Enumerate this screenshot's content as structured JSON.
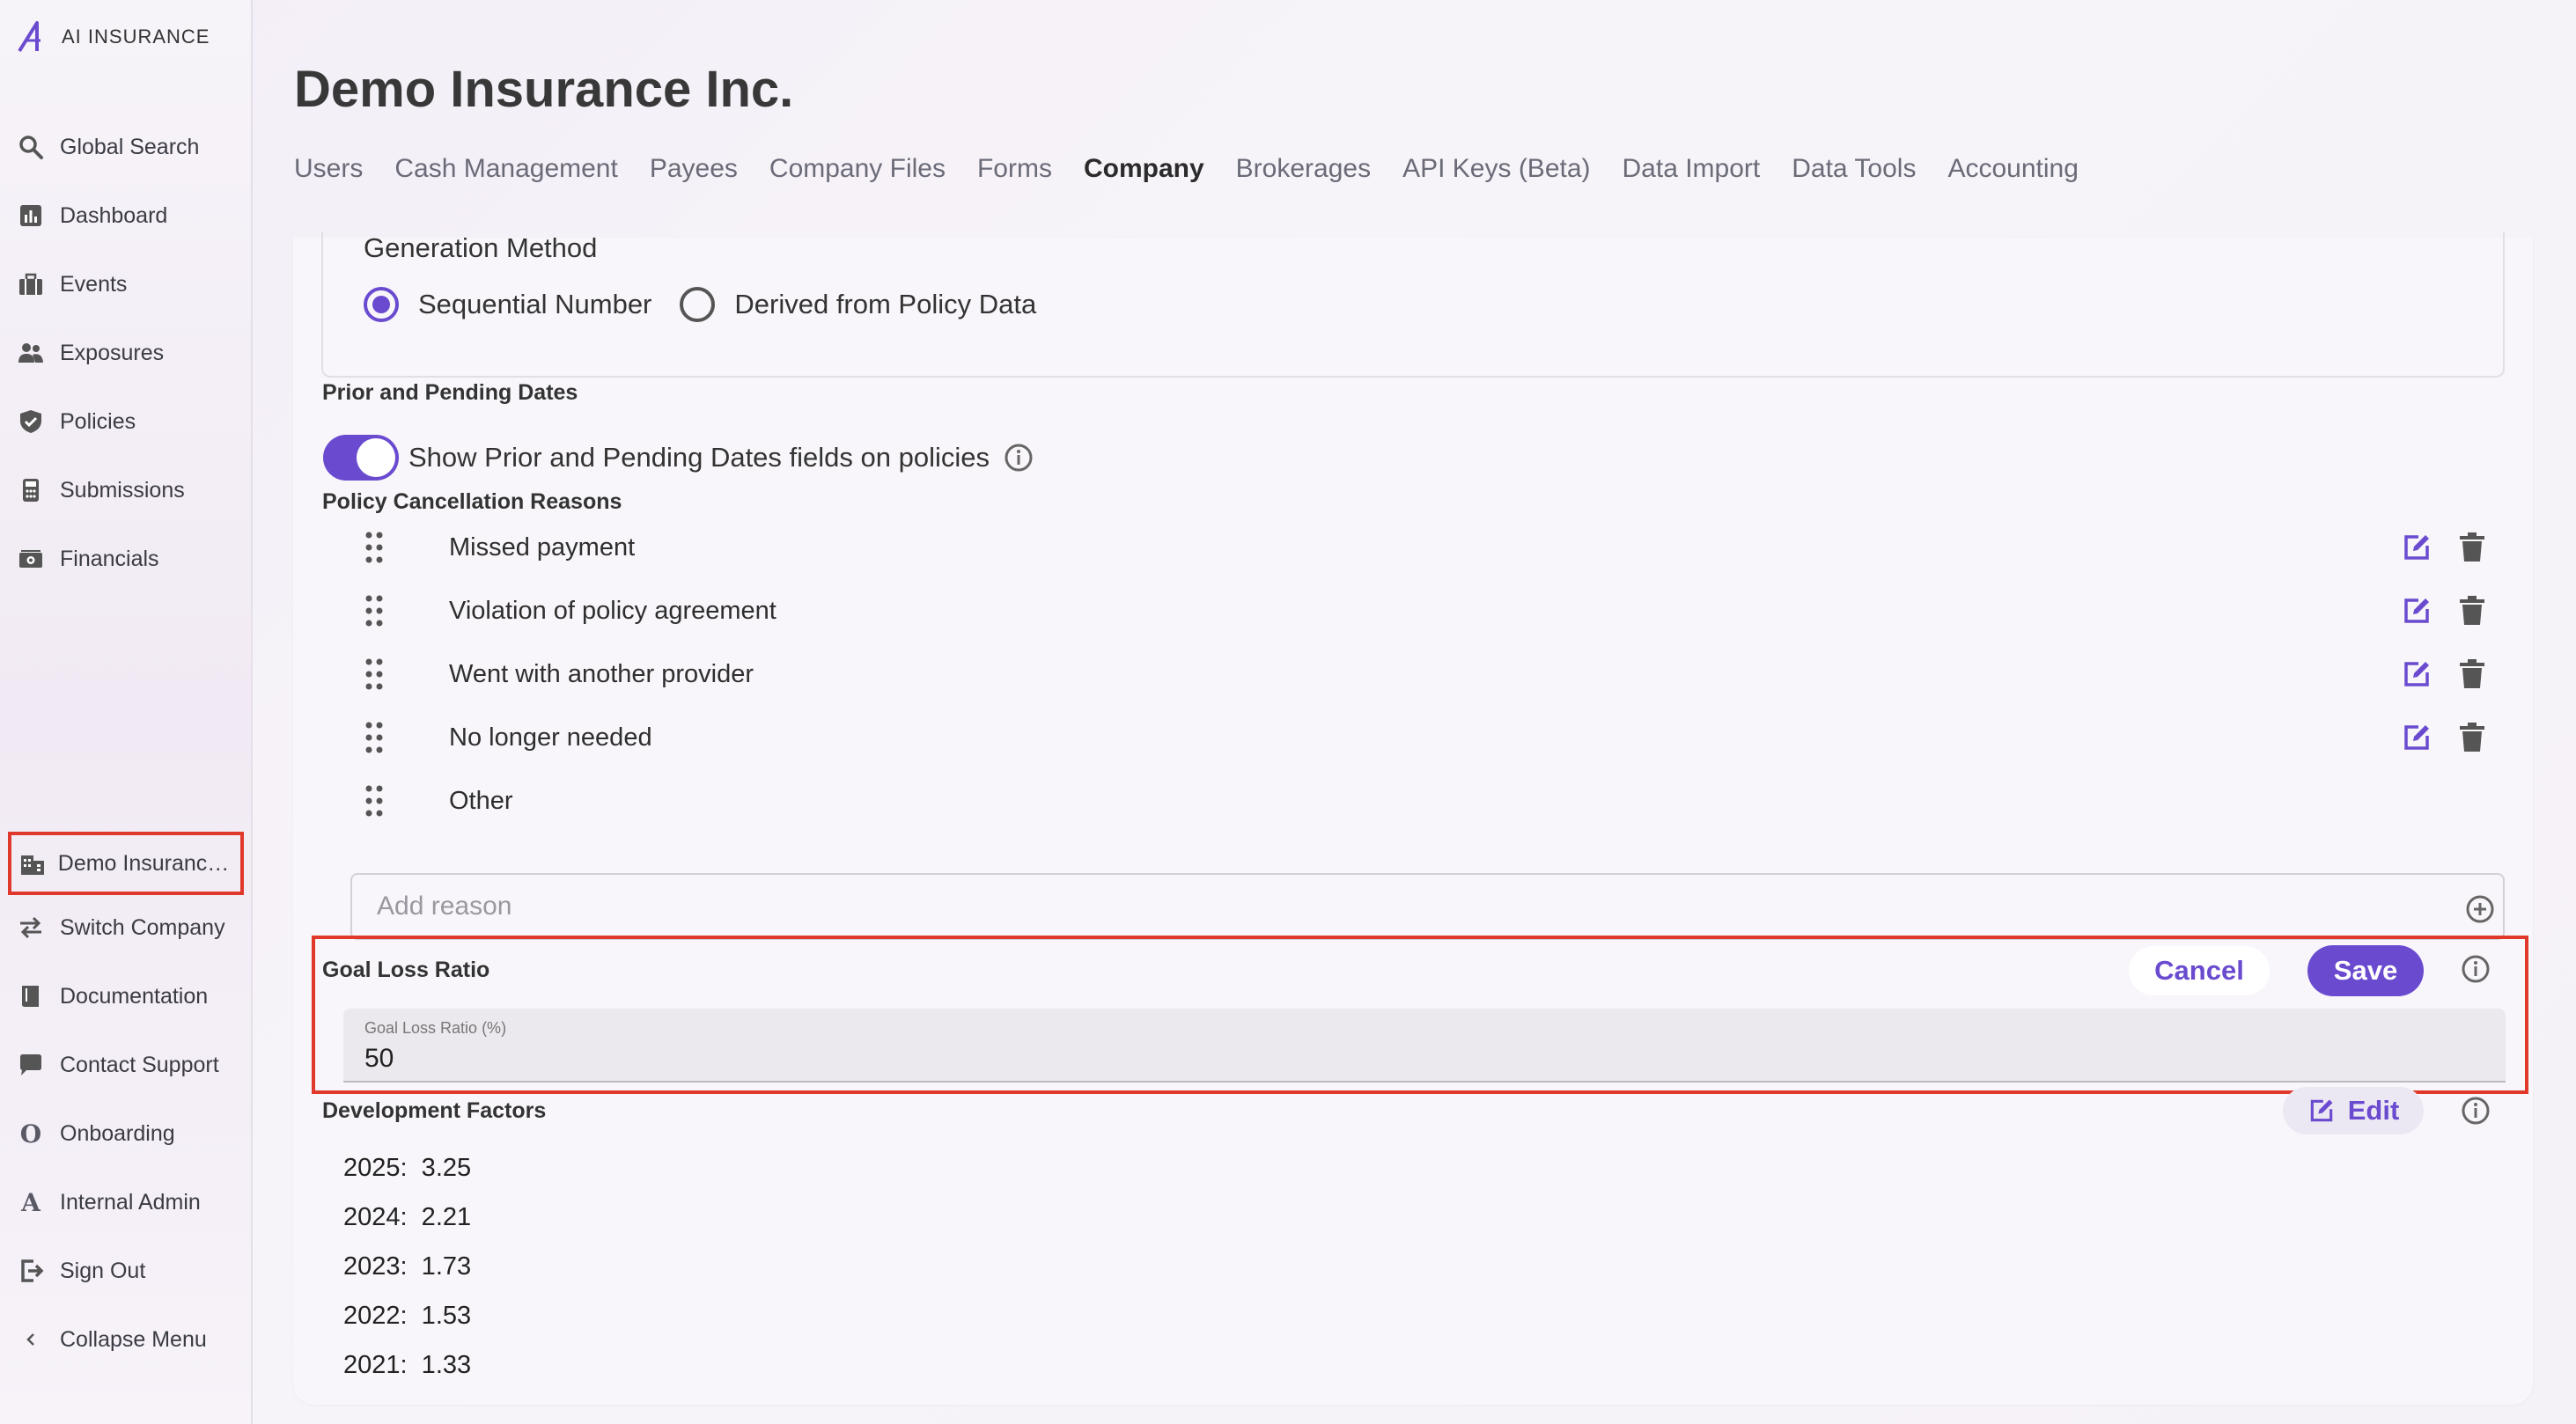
{
  "app": {
    "brand": "AI INSURANCE"
  },
  "sidebar": {
    "items": [
      {
        "label": "Global Search",
        "icon": "search-icon"
      },
      {
        "label": "Dashboard",
        "icon": "dashboard-icon"
      },
      {
        "label": "Events",
        "icon": "briefcase-icon"
      },
      {
        "label": "Exposures",
        "icon": "people-icon"
      },
      {
        "label": "Policies",
        "icon": "shield-icon"
      },
      {
        "label": "Submissions",
        "icon": "calculator-icon"
      },
      {
        "label": "Financials",
        "icon": "money-icon"
      }
    ],
    "bottom_items": [
      {
        "label": "Demo Insurance Inc.",
        "icon": "building-icon"
      },
      {
        "label": "Switch Company",
        "icon": "switch-icon"
      },
      {
        "label": "Documentation",
        "icon": "book-icon"
      },
      {
        "label": "Contact Support",
        "icon": "chat-icon"
      },
      {
        "label": "Onboarding",
        "icon": "letter-o-icon",
        "glyph": "O"
      },
      {
        "label": "Internal Admin",
        "icon": "letter-a-icon",
        "glyph": "A"
      },
      {
        "label": "Sign Out",
        "icon": "sign-out-icon"
      },
      {
        "label": "Collapse Menu",
        "icon": "chevron-left-icon"
      }
    ]
  },
  "header": {
    "title": "Demo Insurance Inc.",
    "tabs": [
      {
        "label": "Users"
      },
      {
        "label": "Cash Management"
      },
      {
        "label": "Payees"
      },
      {
        "label": "Company Files"
      },
      {
        "label": "Forms"
      },
      {
        "label": "Company",
        "active": true
      },
      {
        "label": "Brokerages"
      },
      {
        "label": "API Keys (Beta)"
      },
      {
        "label": "Data Import"
      },
      {
        "label": "Data Tools"
      },
      {
        "label": "Accounting"
      }
    ]
  },
  "generation": {
    "title": "Generation Method",
    "options": [
      "Sequential Number",
      "Derived from Policy Data"
    ],
    "selected": "Sequential Number"
  },
  "prior_pending": {
    "section": "Prior and Pending Dates",
    "toggle_label": "Show Prior and Pending Dates fields on policies",
    "enabled": true
  },
  "cancellation": {
    "section": "Policy Cancellation Reasons",
    "reasons": [
      {
        "text": "Missed payment",
        "editable": true
      },
      {
        "text": "Violation of policy agreement",
        "editable": true
      },
      {
        "text": "Went with another provider",
        "editable": true
      },
      {
        "text": "No longer needed",
        "editable": true
      },
      {
        "text": "Other",
        "editable": false
      }
    ],
    "add_placeholder": "Add reason"
  },
  "goal_loss_ratio": {
    "section": "Goal Loss Ratio",
    "cancel_label": "Cancel",
    "save_label": "Save",
    "field_label": "Goal Loss Ratio (%)",
    "value": "50"
  },
  "development_factors": {
    "section": "Development Factors",
    "edit_label": "Edit",
    "factors": [
      {
        "text": "2025:  3.25"
      },
      {
        "text": "2024:  2.21"
      },
      {
        "text": "2023:  1.73"
      },
      {
        "text": "2022:  1.53"
      },
      {
        "text": "2021:  1.33"
      }
    ]
  },
  "colors": {
    "accent": "#6a4bd0",
    "highlight": "#e0392b",
    "text": "#2a2a2a"
  }
}
